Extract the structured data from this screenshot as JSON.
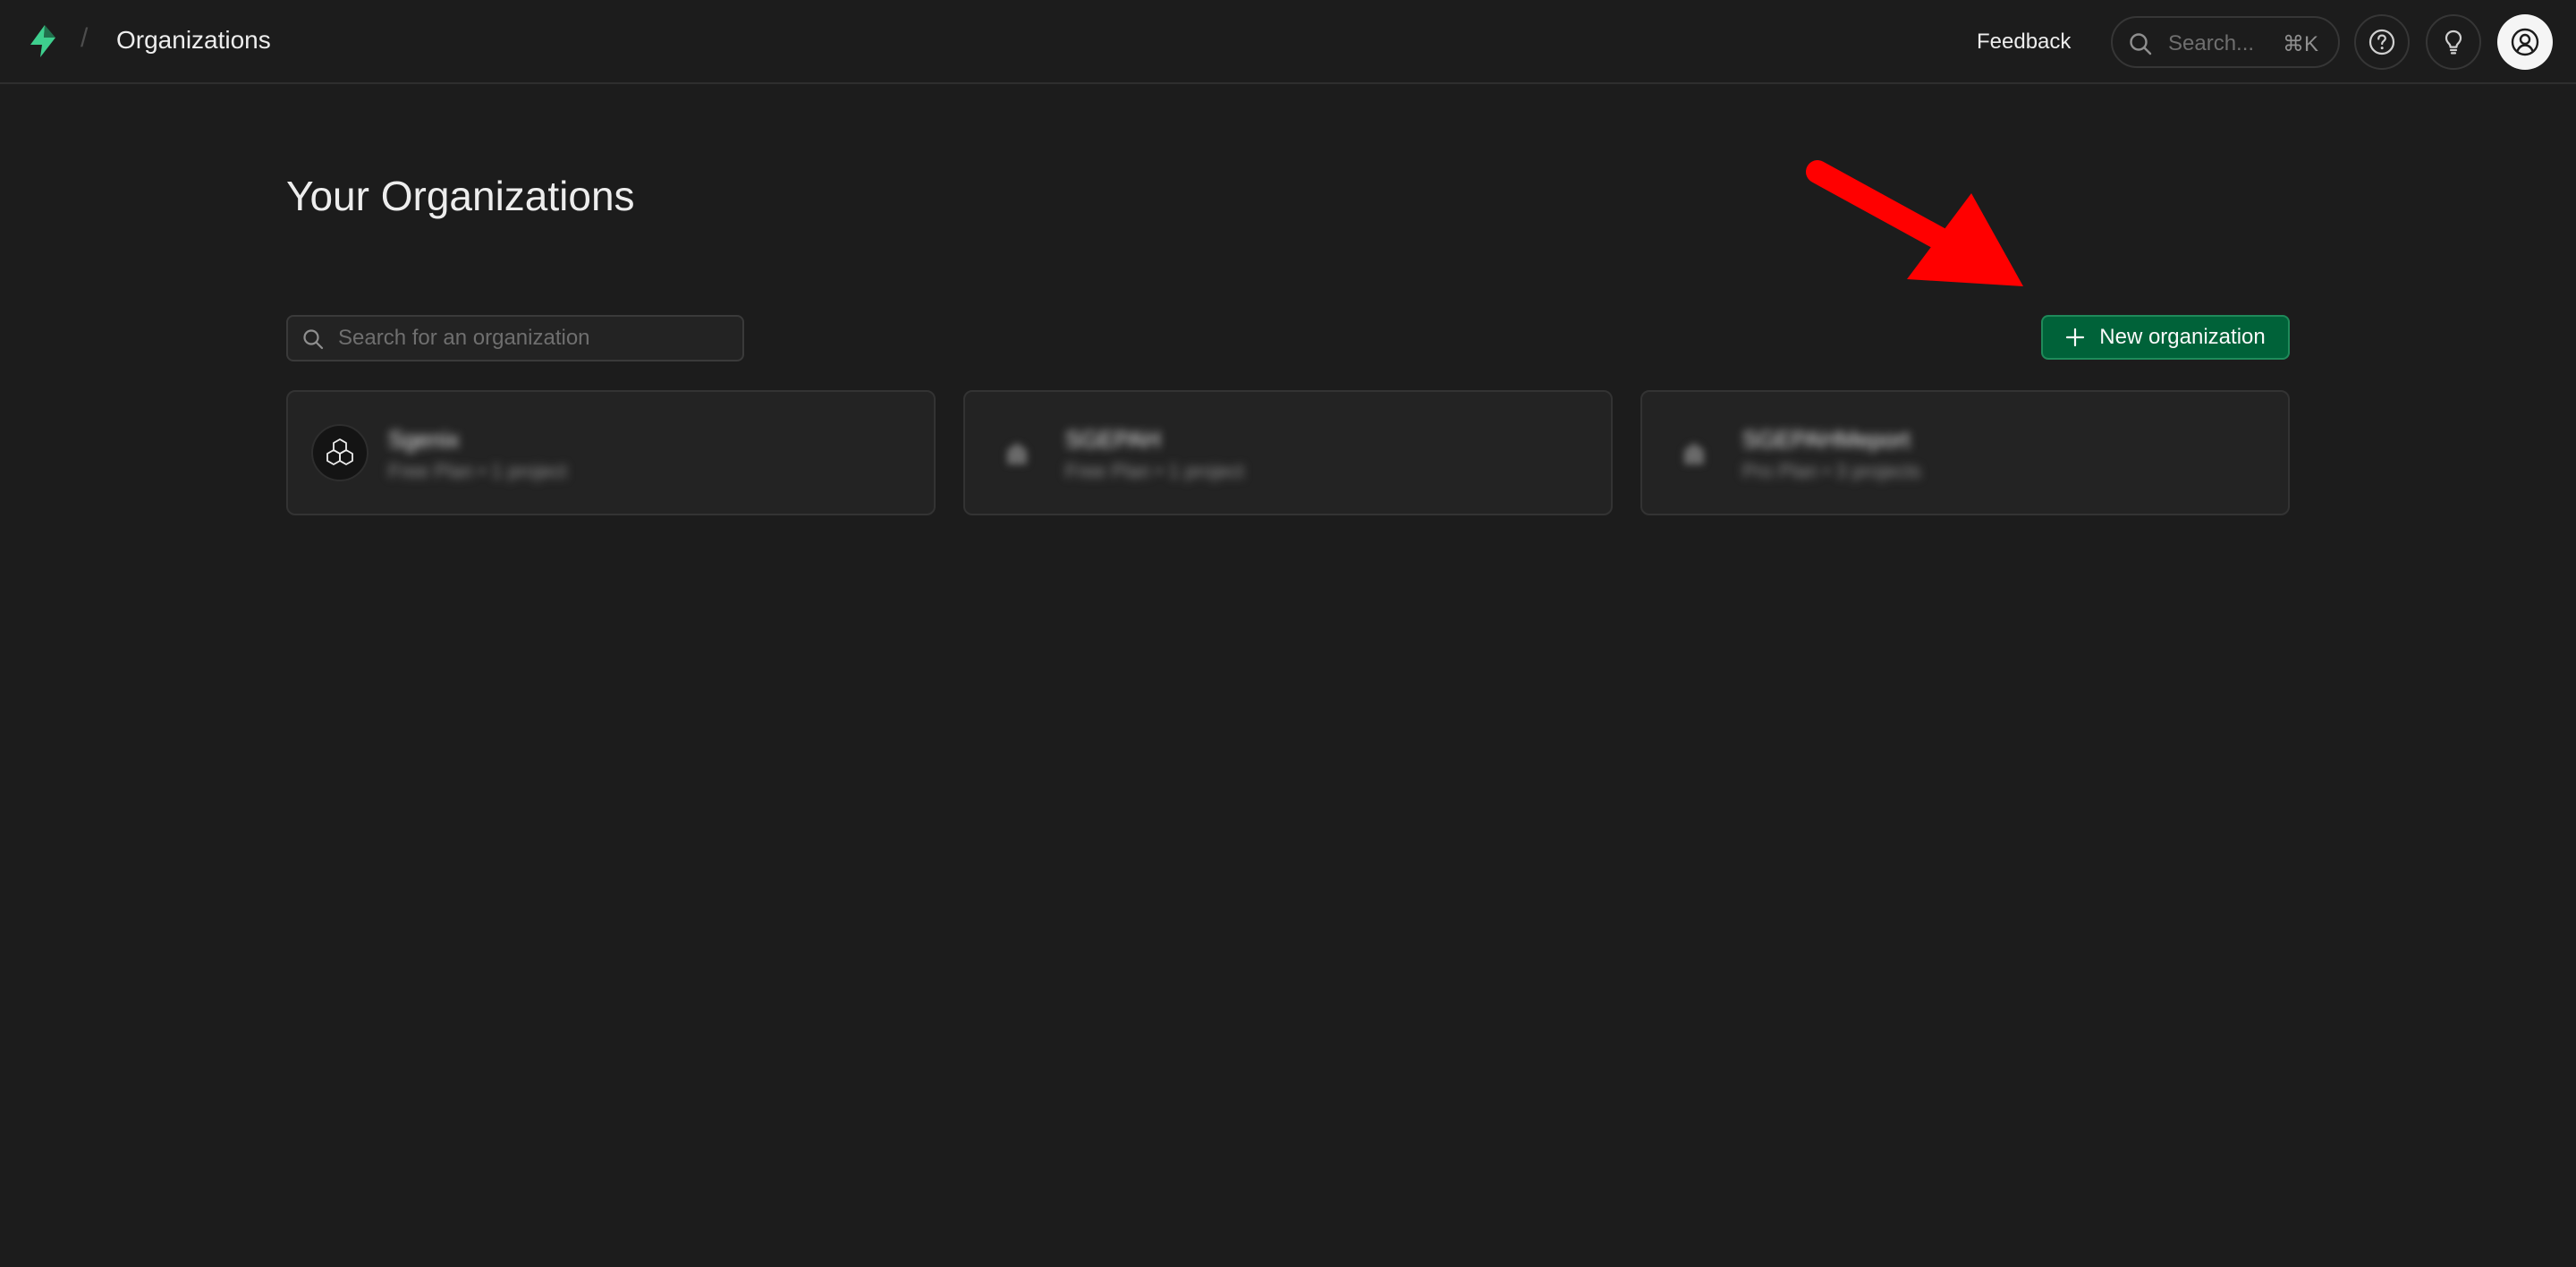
{
  "topbar": {
    "breadcrumb_separator": "/",
    "title": "Organizations",
    "feedback_label": "Feedback",
    "search_placeholder": "Search...",
    "search_shortcut": "⌘K"
  },
  "main": {
    "heading": "Your Organizations",
    "search_placeholder": "Search for an organization",
    "new_org_label": "New organization",
    "new_org_icon": "plus-icon",
    "organizations": [
      {
        "name": "Sgenix",
        "meta": "Free Plan  •  1 project",
        "icon": "cubes-icon"
      },
      {
        "name": "SGEPAH",
        "meta": "Free Plan  •  1 project",
        "icon": "building-icon"
      },
      {
        "name": "SGEPAHMeport",
        "meta": "Pro Plan  •  3 projects",
        "icon": "building-icon"
      }
    ]
  },
  "colors": {
    "background": "#1c1c1c",
    "brand": "#3ecf8e",
    "primary_button": "#006239",
    "annotation_arrow": "#ff0000"
  }
}
